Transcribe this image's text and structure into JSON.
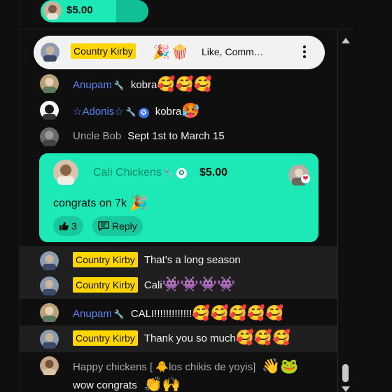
{
  "ticker": {
    "amount": "$5.00"
  },
  "pinned": {
    "author": "Country Kirby",
    "emojis": "🎉🍿",
    "text": "Like, Comm…"
  },
  "messages": [
    {
      "author": "Anupam",
      "body": "kobra",
      "emoji": "🥰🥰🥰"
    },
    {
      "author": "☆Adonis☆",
      "body": "kobra",
      "emoji": "🥵"
    },
    {
      "author": "Uncle Bob",
      "body": "Sept 1st to March 15"
    },
    {
      "author": "Country Kirby",
      "body": "That's a long season"
    },
    {
      "author": "Country Kirby",
      "body": "Cali",
      "emoji": "👾👾👾👾"
    },
    {
      "author": "Anupam",
      "body": "CALI!!!!!!!!!!!!!",
      "emoji": "🥰🥰🥰🥰🥰"
    },
    {
      "author": "Country Kirby",
      "body": "Thank you so much",
      "emoji": "🥰🥰🥰"
    },
    {
      "author": "Happy chickens [ 🐥los chikis de yoyis]",
      "emoji": "👋🐸",
      "body2": "wow congrats",
      "emoji2": "👏🙌"
    }
  ],
  "superchat": {
    "author": "Cali Chickens",
    "amount": "$5.00",
    "text": "congrats on 7k",
    "text_emoji": "🎉",
    "likes": "3",
    "reply_label": "Reply"
  },
  "colors": {
    "accent": "#1de9b6",
    "member_badge": "#ffd600",
    "mod_name": "#5e84f1"
  }
}
